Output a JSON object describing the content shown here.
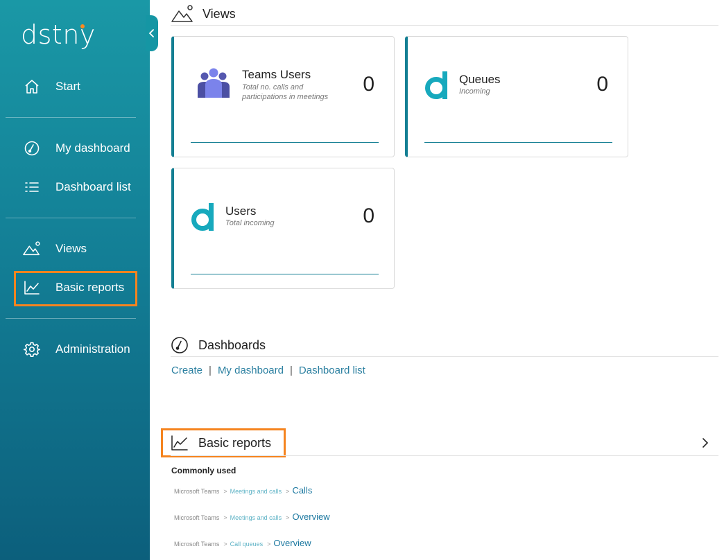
{
  "brand": {
    "logo_text": "dstny",
    "accent": "#f5841f",
    "sidebar_color": "#137f96"
  },
  "sidebar": {
    "items": [
      {
        "label": "Start",
        "icon": "home-icon"
      },
      {
        "label": "My dashboard",
        "icon": "gauge-icon"
      },
      {
        "label": "Dashboard list",
        "icon": "list-icon"
      },
      {
        "label": "Views",
        "icon": "mountain-icon"
      },
      {
        "label": "Basic reports",
        "icon": "line-chart-icon",
        "highlighted": true
      },
      {
        "label": "Administration",
        "icon": "gear-icon"
      }
    ]
  },
  "views": {
    "title": "Views",
    "cards": [
      {
        "title": "Teams Users",
        "subtitle_line1": "Total no. calls and",
        "subtitle_line2": "participations in meetings",
        "value": "0",
        "icon": "teams-users-icon"
      },
      {
        "title": "Queues",
        "subtitle": "Incoming",
        "value": "0",
        "icon": "dstny-d-icon"
      },
      {
        "title": "Users",
        "subtitle": "Total incoming",
        "value": "0",
        "icon": "dstny-d-icon"
      }
    ]
  },
  "dashboards": {
    "title": "Dashboards",
    "links": [
      "Create",
      "My dashboard",
      "Dashboard list"
    ],
    "separator": "|"
  },
  "basic_reports": {
    "title": "Basic reports",
    "highlighted": true,
    "common_label": "Commonly used",
    "items": [
      {
        "c1": "Microsoft Teams",
        "c2": "Meetings and calls",
        "c3": "Calls"
      },
      {
        "c1": "Microsoft Teams",
        "c2": "Meetings and calls",
        "c3": "Overview"
      },
      {
        "c1": "Microsoft Teams",
        "c2": "Call queues",
        "c3": "Overview"
      }
    ],
    "crumb_separator": ">"
  }
}
